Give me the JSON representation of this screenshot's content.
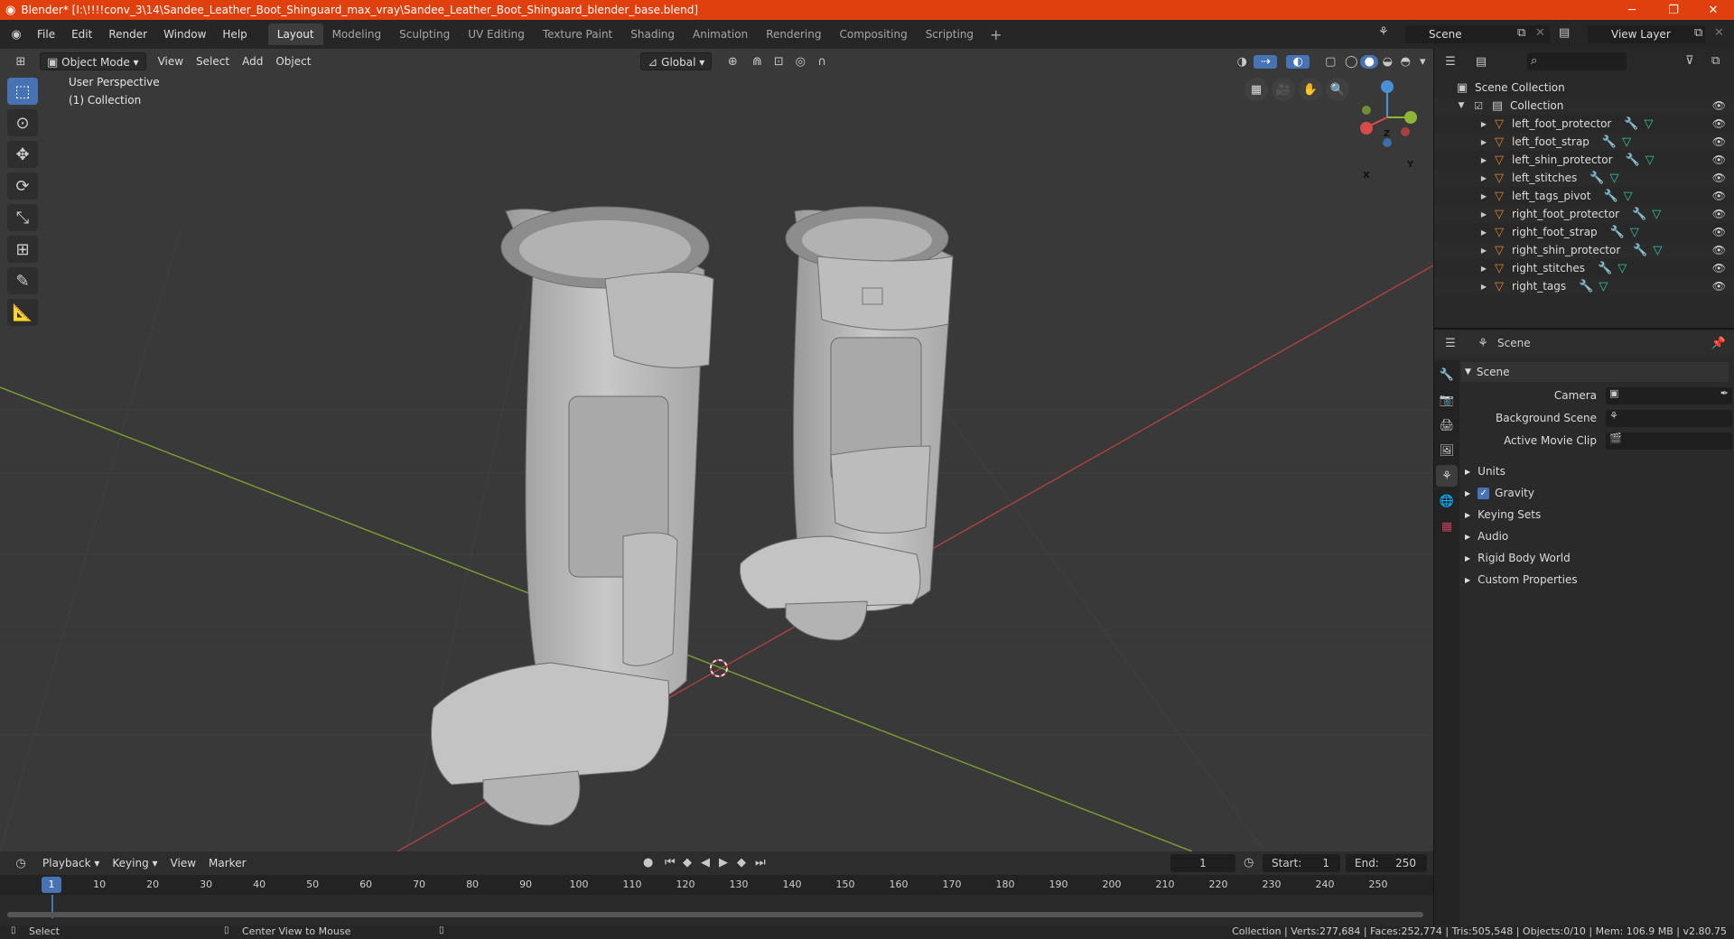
{
  "titlebar": {
    "title": "Blender* [I:\\!!!!conv_3\\14\\Sandee_Leather_Boot_Shinguard_max_vray\\Sandee_Leather_Boot_Shinguard_blender_base.blend]",
    "minimize": "─",
    "maximize": "❐",
    "close": "✕"
  },
  "menu": [
    "File",
    "Edit",
    "Render",
    "Window",
    "Help"
  ],
  "workspaces": [
    "Layout",
    "Modeling",
    "Sculpting",
    "UV Editing",
    "Texture Paint",
    "Shading",
    "Animation",
    "Rendering",
    "Compositing",
    "Scripting"
  ],
  "scene_field": "Scene",
  "view_layer_field": "View Layer",
  "viewport": {
    "mode": "Object Mode",
    "menus": [
      "View",
      "Select",
      "Add",
      "Object"
    ],
    "orientation": "Global",
    "perspective": "User Perspective",
    "collection": "(1) Collection",
    "axis_x": "X",
    "axis_y": "Y",
    "axis_z": "Z"
  },
  "outliner": {
    "search_placeholder": "",
    "scene_collection": "Scene Collection",
    "collection": "Collection",
    "objects": [
      "left_foot_protector",
      "left_foot_strap",
      "left_shin_protector",
      "left_stitches",
      "left_tags_pivot",
      "right_foot_protector",
      "right_foot_strap",
      "right_shin_protector",
      "right_stitches",
      "right_tags"
    ]
  },
  "properties": {
    "header": "Scene",
    "panel": "Scene",
    "camera_label": "Camera",
    "background_scene_label": "Background Scene",
    "active_movie_clip_label": "Active Movie Clip",
    "subpanels": [
      "Units",
      "Gravity",
      "Keying Sets",
      "Audio",
      "Rigid Body World",
      "Custom Properties"
    ]
  },
  "timeline": {
    "menus": [
      "Playback",
      "Keying",
      "View",
      "Marker"
    ],
    "current_frame": "1",
    "start_label": "Start:",
    "start": "1",
    "end_label": "End:",
    "end": "250",
    "ruler": [
      "1",
      "10",
      "20",
      "30",
      "40",
      "50",
      "60",
      "70",
      "80",
      "90",
      "100",
      "110",
      "120",
      "130",
      "140",
      "150",
      "160",
      "170",
      "180",
      "190",
      "200",
      "210",
      "220",
      "230",
      "240",
      "250"
    ]
  },
  "status": {
    "select": "Select",
    "center_view": "Center View to Mouse",
    "info": "Collection | Verts:277,684 | Faces:252,774 | Tris:505,548 | Objects:0/10 | Mem: 106.9 MB | v2.80.75"
  },
  "colors": {
    "title_bg": "#e0400e",
    "accent": "#4772b3",
    "x_axis": "#d64a4a",
    "y_axis": "#8cb635",
    "z_axis": "#4b8fd8",
    "mesh_icon": "#e08a30",
    "modifier_icon": "#6fa4e8",
    "data_icon": "#36c7a7"
  }
}
